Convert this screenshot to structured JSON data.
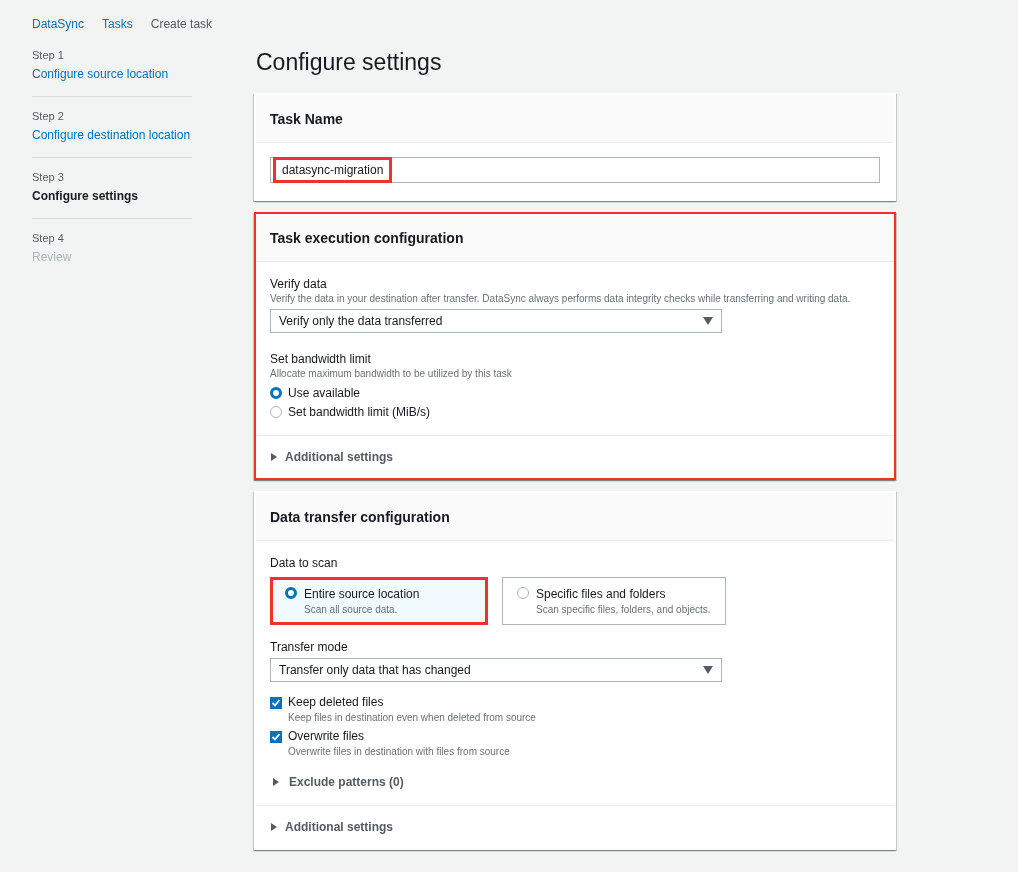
{
  "breadcrumbs": [
    {
      "label": "DataSync",
      "kind": "link"
    },
    {
      "label": "Tasks",
      "kind": "link"
    },
    {
      "label": "Create task",
      "kind": "current"
    }
  ],
  "steps": [
    {
      "step": "Step 1",
      "label": "Configure source location",
      "kind": "link"
    },
    {
      "step": "Step 2",
      "label": "Configure destination location",
      "kind": "link"
    },
    {
      "step": "Step 3",
      "label": "Configure settings",
      "kind": "current"
    },
    {
      "step": "Step 4",
      "label": "Review",
      "kind": "disabled"
    }
  ],
  "title": "Configure settings",
  "task_name": {
    "header": "Task Name",
    "value": "datasync-migration",
    "highlighted": true
  },
  "execution": {
    "header": "Task execution configuration",
    "highlighted": true,
    "verify": {
      "label": "Verify data",
      "description": "Verify the data in your destination after transfer. DataSync always performs data integrity checks while transferring and writing data.",
      "value": "Verify only the data transferred"
    },
    "bandwidth": {
      "label": "Set bandwidth limit",
      "description": "Allocate maximum bandwidth to be utilized by this task",
      "options": [
        {
          "label": "Use available",
          "selected": true
        },
        {
          "label": "Set bandwidth limit (MiB/s)",
          "selected": false
        }
      ]
    },
    "additional": {
      "label": "Additional settings",
      "expanded": false
    }
  },
  "transfer": {
    "header": "Data transfer configuration",
    "highlighted": false,
    "scan": {
      "label": "Data to scan",
      "options": [
        {
          "label": "Entire source location",
          "description": "Scan all source data.",
          "selected": true,
          "highlighted": true
        },
        {
          "label": "Specific files and folders",
          "description": "Scan specific files, folders, and objects.",
          "selected": false,
          "highlighted": false
        }
      ]
    },
    "mode": {
      "label": "Transfer mode",
      "value": "Transfer only data that has changed"
    },
    "checks": [
      {
        "label": "Keep deleted files",
        "description": "Keep files in destination even when deleted from source",
        "checked": true
      },
      {
        "label": "Overwrite files",
        "description": "Overwrite files in destination with files from source",
        "checked": true
      }
    ],
    "exclude": {
      "label": "Exclude patterns (0)",
      "expanded": false
    },
    "additional": {
      "label": "Additional settings",
      "expanded": false
    }
  }
}
